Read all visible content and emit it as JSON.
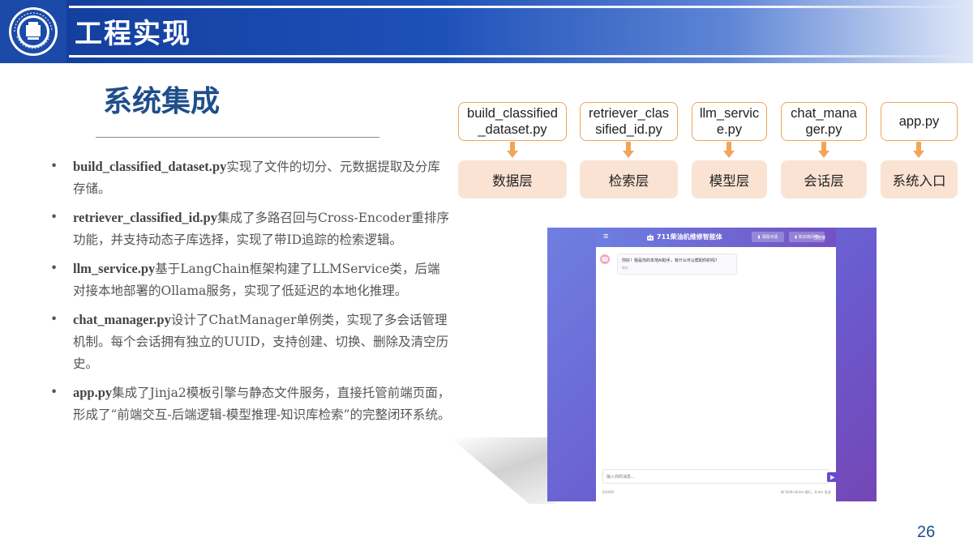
{
  "header": {
    "title": "工程实现"
  },
  "section": {
    "title": "系统集成"
  },
  "bullets": [
    {
      "name": "build_classified_dataset.py",
      "text": "实现了文件的切分、元数据提取及分库存储。"
    },
    {
      "name": "retriever_classified_id.py",
      "text": "集成了多路召回与Cross-Encoder重排序功能，并支持动态子库选择，实现了带ID追踪的检索逻辑。"
    },
    {
      "name": "llm_service.py",
      "text": "基于LangChain框架构建了LLMService类，后端对接本地部署的Ollama服务，实现了低延迟的本地化推理。"
    },
    {
      "name": "chat_manager.py",
      "text": "设计了ChatManager单例类，实现了多会话管理机制。每个会话拥有独立的UUID，支持创建、切换、删除及清空历史。"
    },
    {
      "name": "app.py",
      "text": "集成了Jinja2模板引擎与静态文件服务，直接托管前端页面，形成了“前端交互-后端逻辑-模型推理-知识库检索”的完整闭环系统。"
    }
  ],
  "diagram": {
    "files": [
      "build_classified_dataset.py",
      "retriever_classified_id.py",
      "llm_service.py",
      "chat_manager.py",
      "app.py"
    ],
    "files_display": [
      "build_classifie\nd_dataset.py",
      "retriever_cla\nssified_id.py",
      "llm_servi\nce.py",
      "chat_man\nager.py",
      "app.py"
    ],
    "layers": [
      "数据层",
      "检索层",
      "模型层",
      "会话层",
      "系统入口"
    ],
    "colors": {
      "file_border": "#f0a55a",
      "layer_fill": "#fbe3d3",
      "arrow": "#f0a55a"
    }
  },
  "screenshot": {
    "title": "711柴油机维修智能体",
    "buttons": [
      "清除对话",
      "知识库问答"
    ],
    "status": "已连接",
    "message": "你好！我是你的本地AI助手，有什么可以帮助你的吗？",
    "message_time": "现在",
    "input_placeholder": "输入你的消息...",
    "char_count": "0/2000",
    "hint": "按 Shift+Enter 换行，Enter 发送"
  },
  "page_number": "26",
  "colors": {
    "banner": "#1d50b8",
    "title_blue": "#1f4e8c",
    "app_purple": "#6b48d0"
  }
}
